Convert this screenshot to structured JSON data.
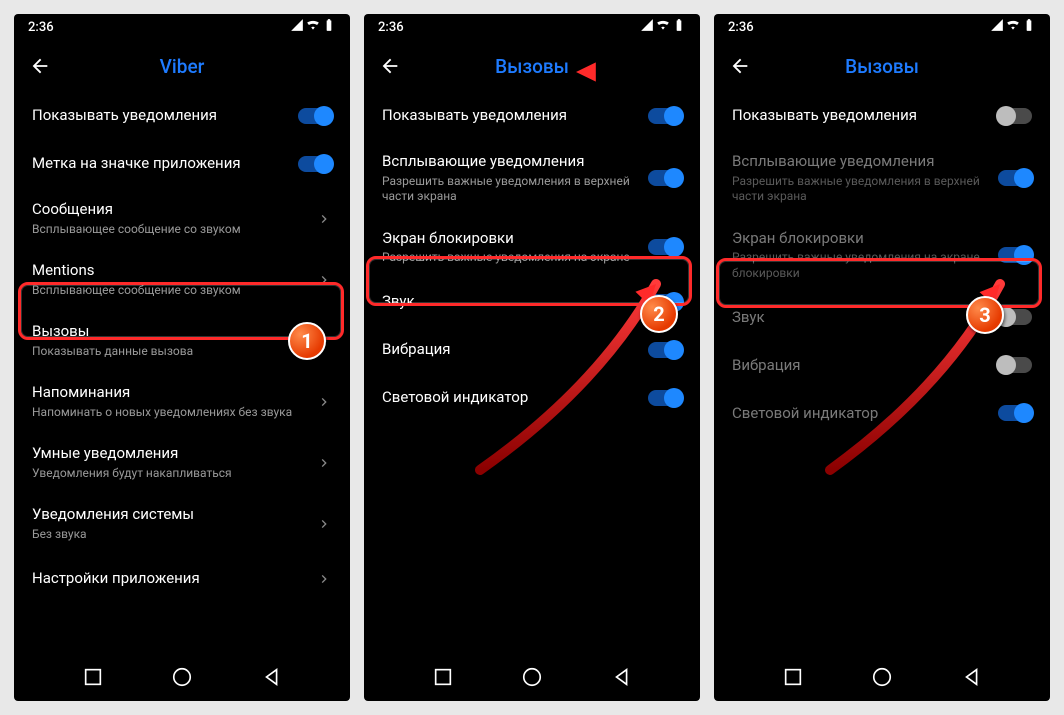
{
  "status_time": "2:36",
  "screens": [
    {
      "title": "Viber",
      "rows": [
        {
          "label": "Показывать уведомления",
          "control": "toggle",
          "on": true
        },
        {
          "label": "Метка на значке приложения",
          "control": "toggle",
          "on": true
        },
        {
          "label": "Сообщения",
          "sub": "Всплывающее сообщение со звуком",
          "control": "chevron"
        },
        {
          "label": "Mentions",
          "sub": "Всплывающее сообщение со звуком",
          "control": "chevron"
        },
        {
          "label": "Вызовы",
          "sub": "Показывать данные вызова",
          "control": "chevron"
        },
        {
          "label": "Напоминания",
          "sub": "Напоминать о новых уведомлениях без звука",
          "control": "chevron"
        },
        {
          "label": "Умные уведомления",
          "sub": "Уведомления будут накапливаться",
          "control": "chevron"
        },
        {
          "label": "Уведомления системы",
          "sub": "Без звука",
          "control": "chevron"
        },
        {
          "label": "Настройки приложения",
          "control": "chevron"
        }
      ]
    },
    {
      "title": "Вызовы",
      "rows": [
        {
          "label": "Показывать уведомления",
          "control": "toggle",
          "on": true
        },
        {
          "label": "Всплывающие уведомления",
          "sub": "Разрешить важные уведомления в верхней части экрана",
          "control": "toggle",
          "on": true
        },
        {
          "label": "Экран блокировки",
          "sub": "Разрешить важные уведомления на экране",
          "control": "toggle",
          "on": true
        },
        {
          "label": "Звук",
          "control": "toggle",
          "on": true
        },
        {
          "label": "Вибрация",
          "control": "toggle",
          "on": true
        },
        {
          "label": "Световой индикатор",
          "control": "toggle",
          "on": true
        }
      ]
    },
    {
      "title": "Вызовы",
      "rows": [
        {
          "label": "Показывать уведомления",
          "control": "toggle",
          "on": false
        },
        {
          "label": "Всплывающие уведомления",
          "sub": "Разрешить важные уведомления в верхней части экрана",
          "control": "toggle",
          "on": true,
          "dim": true
        },
        {
          "label": "Экран блокировки",
          "sub": "Разрешить важные уведомления на экране блокировки",
          "control": "toggle",
          "on": true,
          "dim": true
        },
        {
          "label": "Звук",
          "control": "toggle",
          "on": false,
          "dim": true
        },
        {
          "label": "Вибрация",
          "control": "toggle",
          "on": false,
          "dim": true
        },
        {
          "label": "Световой индикатор",
          "control": "toggle",
          "on": true,
          "dim": true
        }
      ]
    }
  ],
  "badges": [
    "1",
    "2",
    "3"
  ]
}
